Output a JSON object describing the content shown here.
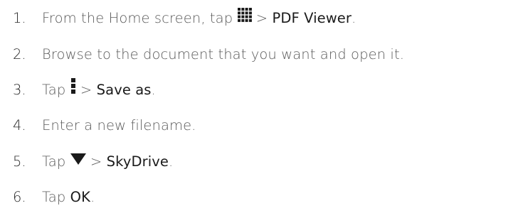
{
  "steps": [
    {
      "number": "1.",
      "text_before": "From the Home screen, tap ",
      "icon": "apps-grid-icon",
      "text_after": " > ",
      "target": "PDF Viewer",
      "end": "."
    },
    {
      "number": "2.",
      "text": "Browse to the document that you want and open it."
    },
    {
      "number": "3.",
      "text_before": "Tap ",
      "icon": "overflow-menu-icon",
      "text_after": " > ",
      "target": "Save as",
      "end": "."
    },
    {
      "number": "4.",
      "text": "Enter a new filename."
    },
    {
      "number": "5.",
      "text_before": "Tap ",
      "icon": "dropdown-triangle-icon",
      "text_after": " > ",
      "target": "SkyDrive",
      "end": "."
    },
    {
      "number": "6.",
      "text_before": "Tap ",
      "target": "OK",
      "end": "."
    }
  ],
  "colors": {
    "text": "#5a5a5a",
    "emphasis": "#1a1a1a",
    "icon": "#1a1a1a"
  }
}
